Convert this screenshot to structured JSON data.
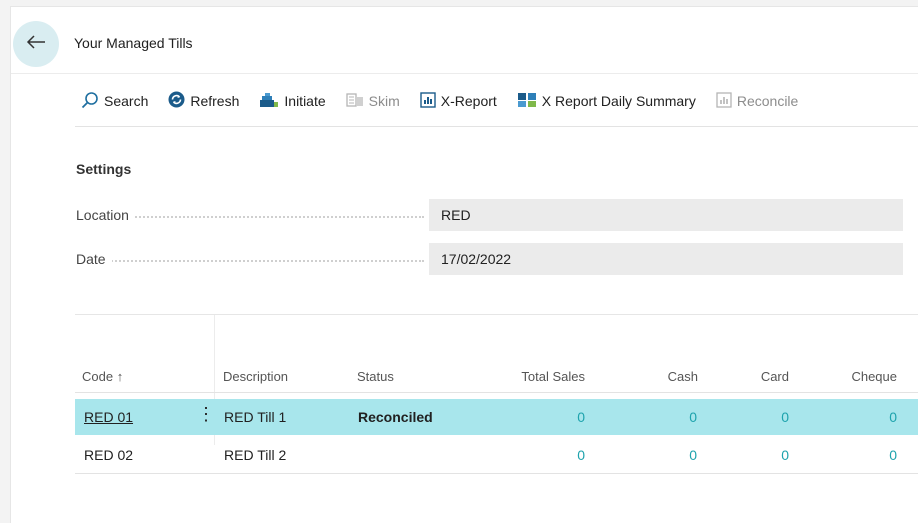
{
  "header": {
    "title": "Your Managed Tills"
  },
  "toolbar": {
    "search": "Search",
    "refresh": "Refresh",
    "initiate": "Initiate",
    "skim": "Skim",
    "x_report": "X-Report",
    "x_report_daily": "X Report Daily Summary",
    "reconcile": "Reconcile"
  },
  "settings": {
    "title": "Settings",
    "location_label": "Location",
    "location_value": "RED",
    "date_label": "Date",
    "date_value": "17/02/2022"
  },
  "table": {
    "columns": {
      "code": "Code ↑",
      "description": "Description",
      "status": "Status",
      "total_sales": "Total Sales",
      "cash": "Cash",
      "card": "Card",
      "cheque": "Cheque"
    },
    "rows": [
      {
        "code": "RED 01",
        "description": "RED Till 1",
        "status": "Reconciled",
        "total_sales": "0",
        "cash": "0",
        "card": "0",
        "cheque": "0"
      },
      {
        "code": "RED 02",
        "description": "RED Till 2",
        "status": "",
        "total_sales": "0",
        "cash": "0",
        "card": "0",
        "cheque": "0"
      }
    ]
  },
  "colors": {
    "accent": "#1ea3ad",
    "selected_row": "#a8e6ec"
  }
}
